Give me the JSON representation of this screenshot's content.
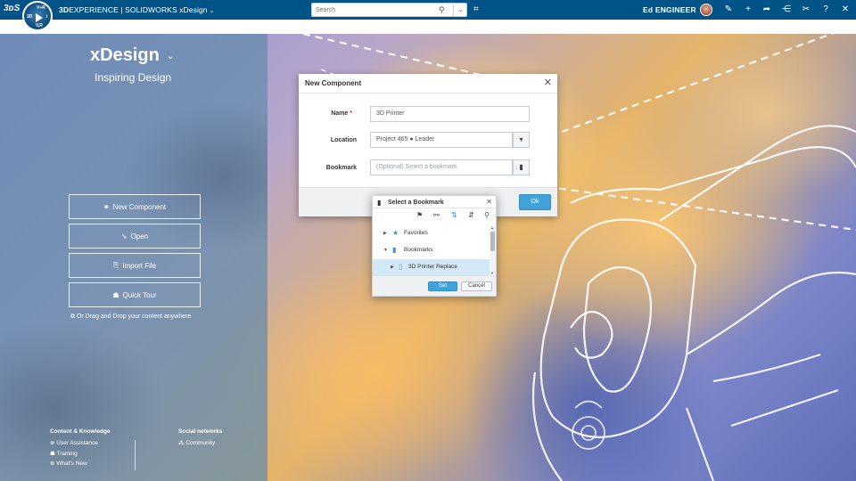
{
  "topbar": {
    "ds_logo": "3ᴅS",
    "compass": {
      "north": "V+R",
      "east": "3D",
      "west": "i",
      "south": "V,R"
    },
    "brand_3d": "3D",
    "brand_experience": "EXPERIENCE",
    "brand_solidworks": " | SOLIDWORKS ",
    "brand_app": "xDesign",
    "search_placeholder": "Search",
    "user_name": "Ed ENGINEER",
    "icons": [
      "tag-icon",
      "avatar",
      "comment-icon",
      "plus-icon",
      "share-arrow-icon",
      "network-share-icon",
      "tools-icon",
      "help-icon",
      "collapse-icon"
    ]
  },
  "left": {
    "title": "xDesign",
    "subtitle": "Inspiring Design",
    "buttons": [
      {
        "label": "New Component",
        "icon": "✷"
      },
      {
        "label": "Open",
        "icon": "➘"
      },
      {
        "label": "Import File",
        "icon": "⎘"
      },
      {
        "label": "Quick Tour",
        "icon": "☗"
      }
    ],
    "drop_hint": "Or Drag and Drop your content anywhere",
    "footer": {
      "col1_heading": "Content & Knowledge",
      "col1_links": [
        "User Assistance",
        "Training",
        "What's New"
      ],
      "col2_heading": "Social networks",
      "col2_links": [
        "Community"
      ]
    }
  },
  "dialog": {
    "title": "New Component",
    "name_label": "Name",
    "name_required": "*",
    "name_value": "3D Printer",
    "location_label": "Location",
    "location_value": "Project 465 ● Leader",
    "bookmark_label": "Bookmark",
    "bookmark_placeholder": "(Optional) Select a bookmark",
    "ok_label": "Ok"
  },
  "bookmark_popup": {
    "title": "Select a Bookmark",
    "tree": [
      {
        "label": "Favorites",
        "level": 0,
        "expanded": false,
        "selected": false
      },
      {
        "label": "Bookmarks",
        "level": 0,
        "expanded": true,
        "selected": false
      },
      {
        "label": "3D Printer Replace",
        "level": 1,
        "expanded": false,
        "selected": true
      }
    ],
    "set_label": "Set",
    "cancel_label": "Cancel"
  }
}
